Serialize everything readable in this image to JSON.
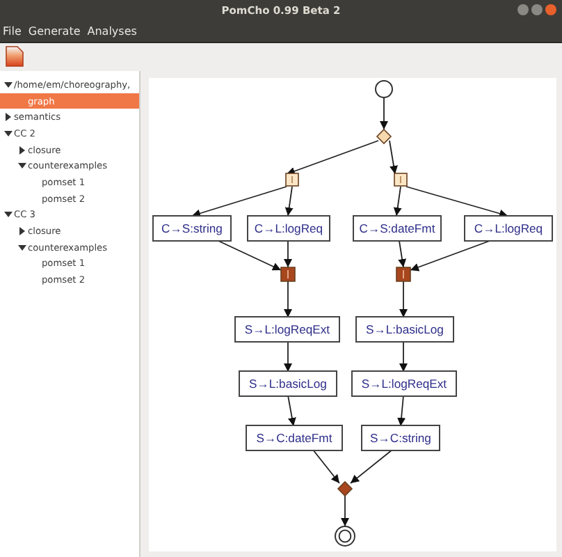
{
  "window": {
    "title": "PomCho 0.99 Beta 2"
  },
  "menu": [
    "File",
    "Generate",
    "Analyses"
  ],
  "tree": [
    {
      "label": "/home/em/choreography,",
      "expanded": true,
      "selected": false,
      "children": [
        {
          "label": "graph",
          "selected": true
        }
      ]
    },
    {
      "label": "semantics",
      "expanded": false,
      "selected": false
    },
    {
      "label": "CC 2",
      "expanded": true,
      "selected": false,
      "children": [
        {
          "label": "closure",
          "expanded": false,
          "selected": false
        },
        {
          "label": "counterexamples",
          "expanded": true,
          "selected": false,
          "children": [
            {
              "label": "pomset 1",
              "selected": false
            },
            {
              "label": "pomset 2",
              "selected": false
            }
          ]
        }
      ]
    },
    {
      "label": "CC 3",
      "expanded": true,
      "selected": false,
      "children": [
        {
          "label": "closure",
          "expanded": false,
          "selected": false
        },
        {
          "label": "counterexamples",
          "expanded": true,
          "selected": false,
          "children": [
            {
              "label": "pomset 1",
              "selected": false
            },
            {
              "label": "pomset 2",
              "selected": false
            }
          ]
        }
      ]
    }
  ],
  "graph": {
    "nodes": [
      {
        "kind": "start"
      },
      {
        "kind": "choice"
      },
      {
        "kind": "fork"
      },
      {
        "kind": "fork"
      },
      {
        "kind": "task",
        "label": "C→S:string"
      },
      {
        "kind": "task",
        "label": "C→L:logReq"
      },
      {
        "kind": "task",
        "label": "C→S:dateFmt"
      },
      {
        "kind": "task",
        "label": "C→L:logReq"
      },
      {
        "kind": "join"
      },
      {
        "kind": "join"
      },
      {
        "kind": "task",
        "label": "S→L:logReqExt"
      },
      {
        "kind": "task",
        "label": "S→L:basicLog"
      },
      {
        "kind": "task",
        "label": "S→L:basicLog"
      },
      {
        "kind": "task",
        "label": "S→L:logReqExt"
      },
      {
        "kind": "task",
        "label": "S→C:dateFmt"
      },
      {
        "kind": "task",
        "label": "S→C:string"
      },
      {
        "kind": "merge"
      },
      {
        "kind": "end"
      }
    ]
  }
}
